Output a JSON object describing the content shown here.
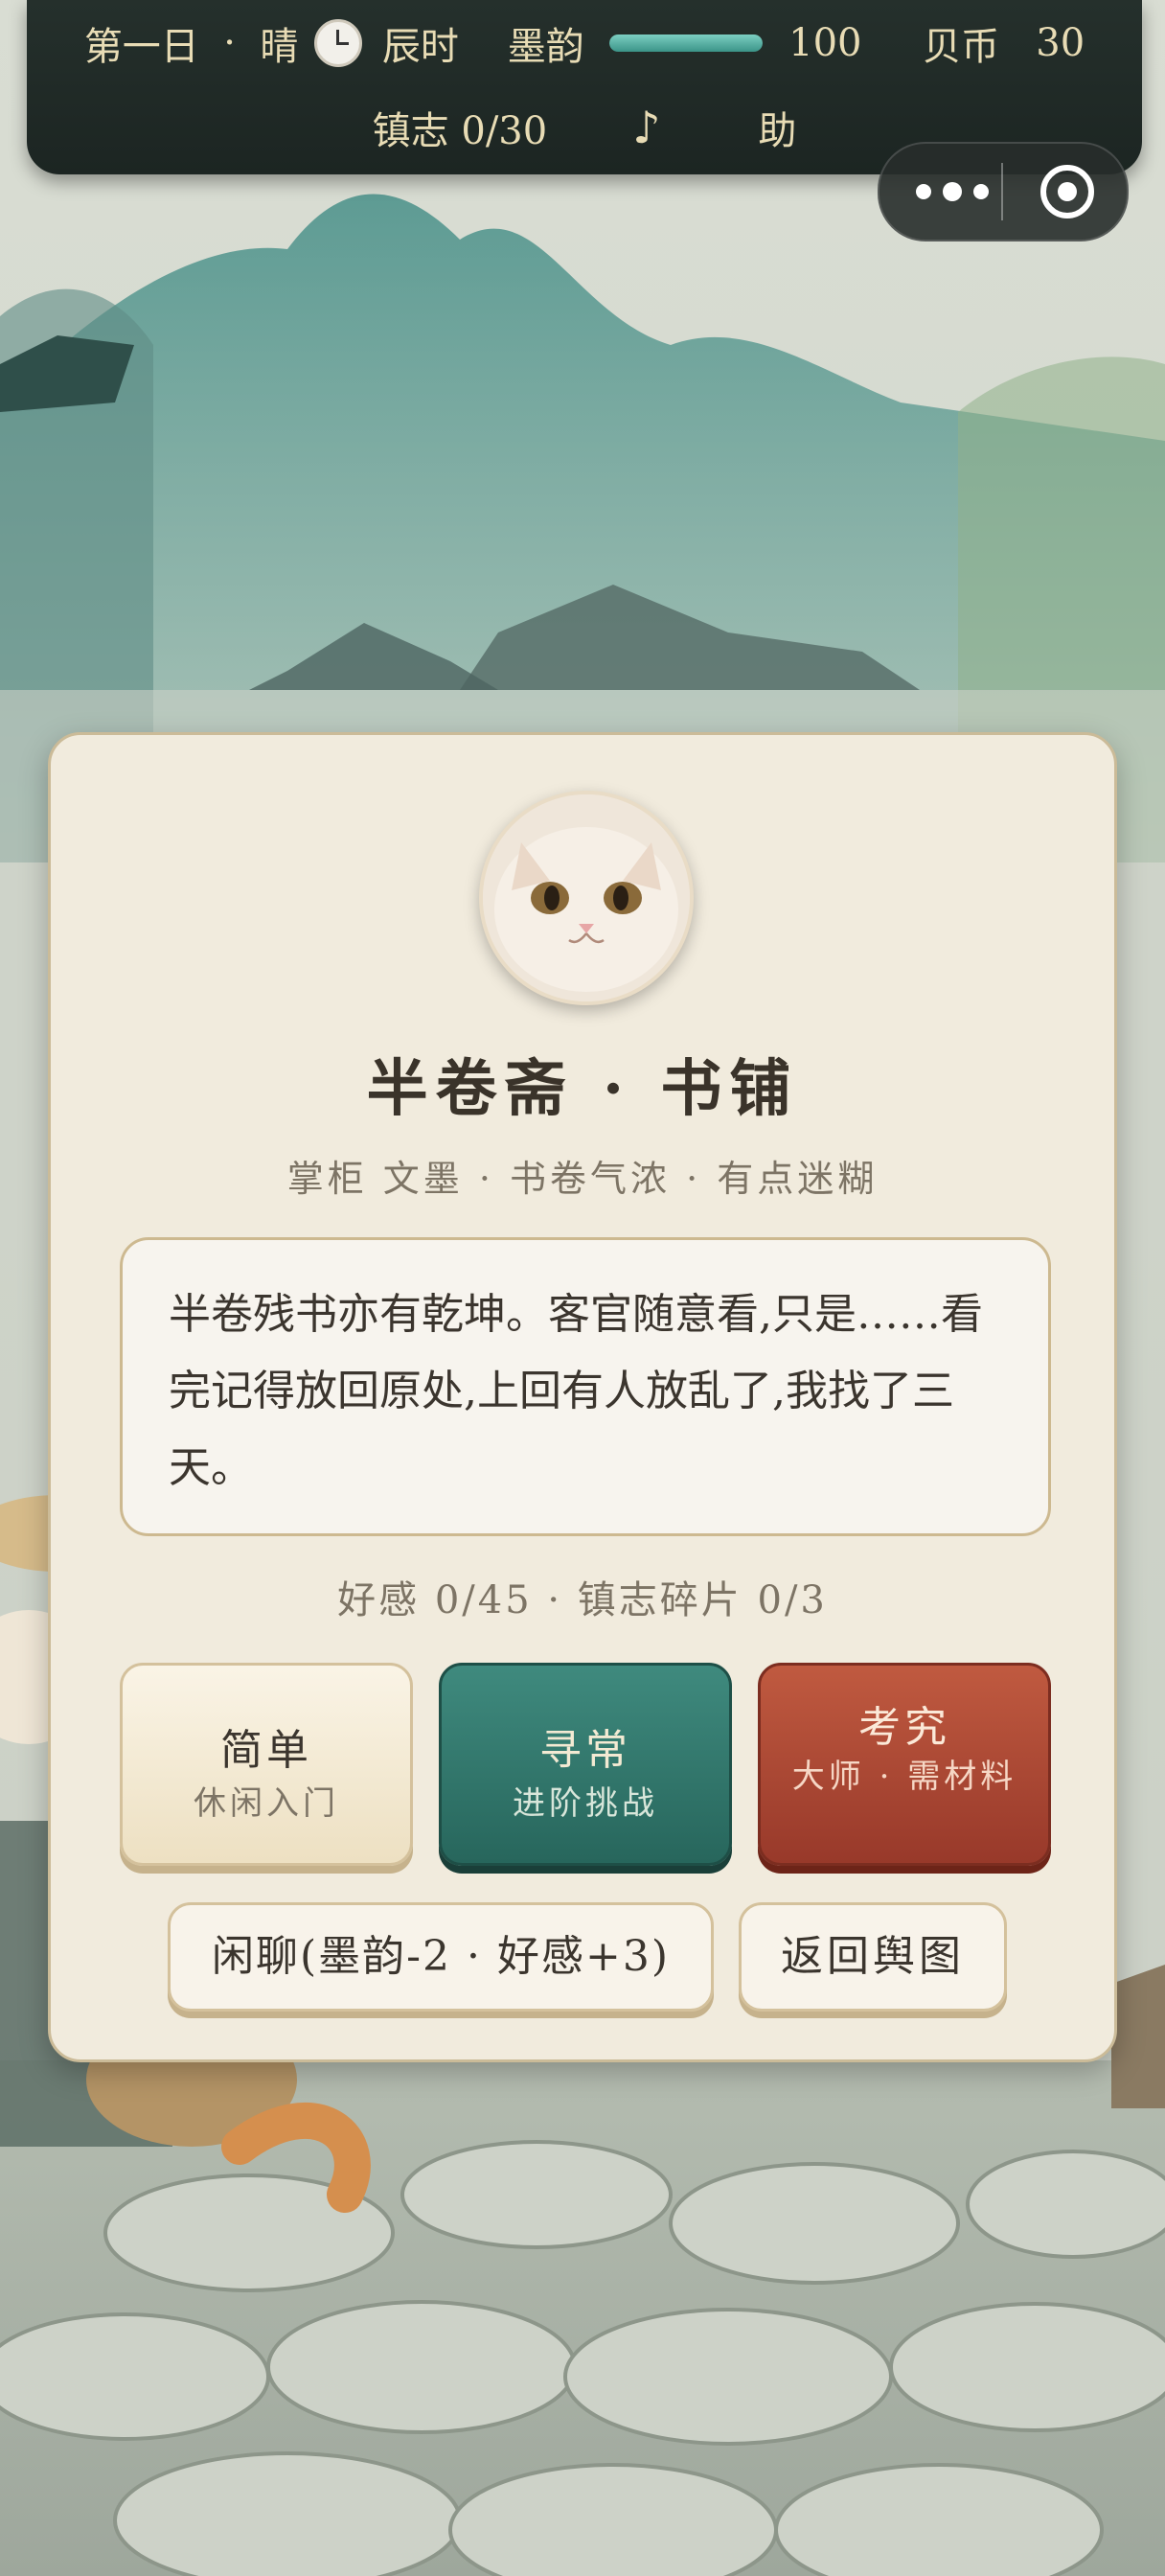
{
  "hud": {
    "day": "第一日",
    "weather": "晴",
    "time": "辰时",
    "ink_label": "墨韵",
    "ink_value": "100",
    "ink_fraction": 1.0,
    "coin_label": "贝币",
    "coin_value": "30",
    "journal": "镇志 0/30",
    "music_symbol": "♪",
    "help_label": "助"
  },
  "shop": {
    "title": "半卷斋 · 书铺",
    "subtitle": "掌柜 文墨 · 书卷气浓 · 有点迷糊",
    "dialogue": "半卷残书亦有乾坤。客官随意看,只是……看完记得放回原处,上回有人放乱了,我找了三天。",
    "stats": "好感 0/45 · 镇志碎片 0/3"
  },
  "difficulty": {
    "easy_title": "简单",
    "easy_desc": "休闲入门",
    "normal_title": "寻常",
    "normal_desc": "进阶挑战",
    "hard_title": "考究",
    "hard_desc": "大师 · 需材料"
  },
  "actions": {
    "chat": "闲聊(墨韵-2 · 好感+3)",
    "back": "返回舆图"
  },
  "colors": {
    "hud_bg": "#1f2825",
    "hud_text": "#e8dcb5",
    "card_bg": "#f1ebdd",
    "teal": "#2f7468",
    "red": "#a8432f"
  }
}
